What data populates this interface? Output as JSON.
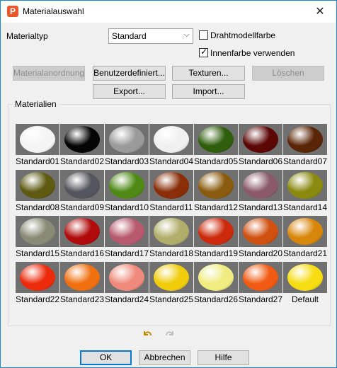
{
  "window": {
    "title": "Materialauswahl",
    "app_icon_letter": "P",
    "close_glyph": "✕"
  },
  "form": {
    "materialtyp_label": "Materialtyp",
    "materialtyp_value": "Standard",
    "drahtmodell_label": "Drahtmodellfarbe",
    "drahtmodell_checked": false,
    "innenfarbe_label": "Innenfarbe verwenden",
    "innenfarbe_checked": true
  },
  "buttons": {
    "materialanordnung": "Materialanordnung...",
    "benutzerdefiniert": "Benutzerdefiniert...",
    "texturen": "Texturen...",
    "loeschen": "Löschen",
    "export": "Export...",
    "import": "Import..."
  },
  "materials_group_label": "Materialien",
  "materials": [
    {
      "name": "Standard01",
      "color": "#f4f4f4"
    },
    {
      "name": "Standard02",
      "color": "#050505"
    },
    {
      "name": "Standard03",
      "color": "#9a9a9a"
    },
    {
      "name": "Standard04",
      "color": "#f0f0f0"
    },
    {
      "name": "Standard05",
      "color": "#2f5e0c"
    },
    {
      "name": "Standard06",
      "color": "#5c0606"
    },
    {
      "name": "Standard07",
      "color": "#5a2506"
    },
    {
      "name": "Standard08",
      "color": "#5e5a12"
    },
    {
      "name": "Standard09",
      "color": "#55555f"
    },
    {
      "name": "Standard10",
      "color": "#4f8a16"
    },
    {
      "name": "Standard11",
      "color": "#8a2e08"
    },
    {
      "name": "Standard12",
      "color": "#8a5a0e"
    },
    {
      "name": "Standard13",
      "color": "#8a5a6a"
    },
    {
      "name": "Standard14",
      "color": "#8a8a10"
    },
    {
      "name": "Standard15",
      "color": "#8a8a76"
    },
    {
      "name": "Standard16",
      "color": "#b00a0a"
    },
    {
      "name": "Standard17",
      "color": "#b85a6e"
    },
    {
      "name": "Standard18",
      "color": "#b0ae6a"
    },
    {
      "name": "Standard19",
      "color": "#cc2a0a"
    },
    {
      "name": "Standard20",
      "color": "#d05010"
    },
    {
      "name": "Standard21",
      "color": "#d8860a"
    },
    {
      "name": "Standard22",
      "color": "#ee2a0c"
    },
    {
      "name": "Standard23",
      "color": "#f07010"
    },
    {
      "name": "Standard24",
      "color": "#f08a7a"
    },
    {
      "name": "Standard25",
      "color": "#f0cc0a"
    },
    {
      "name": "Standard26",
      "color": "#f0ec80"
    },
    {
      "name": "Standard27",
      "color": "#f05a12"
    },
    {
      "name": "Default",
      "color": "#f6dc10"
    }
  ],
  "history": {
    "undo_icon": "undo-icon",
    "redo_icon": "redo-icon"
  },
  "footer": {
    "ok": "OK",
    "abbrechen": "Abbrechen",
    "hilfe": "Hilfe"
  }
}
